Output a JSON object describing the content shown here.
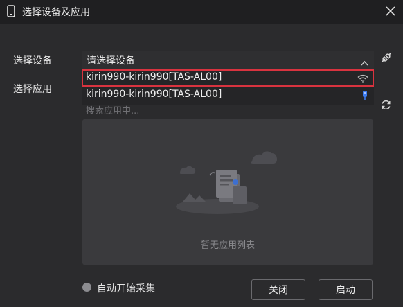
{
  "window": {
    "title": "选择设备及应用",
    "title_icon": "phone-icon",
    "close_icon": "close-icon"
  },
  "device": {
    "label": "选择设备",
    "placeholder": "请选择设备",
    "expanded": true,
    "options": [
      {
        "name": "kirin990-kirin990[TAS-AL00]",
        "connection": "wifi-icon",
        "selected": true
      },
      {
        "name": "kirin990-kirin990[TAS-AL00]",
        "connection": "usb-icon",
        "selected": false
      }
    ],
    "side_icon": "connect-icon"
  },
  "app": {
    "label": "选择应用",
    "search_placeholder": "搜索应用中...",
    "refresh_icon": "refresh-icon",
    "empty_text": "暂无应用列表",
    "empty_icon": "empty-documents-icon"
  },
  "footer": {
    "auto_start_label": "自动开始采集",
    "auto_start_checked": false,
    "close_label": "关闭",
    "start_label": "启动"
  },
  "colors": {
    "background": "#2b2b2d",
    "titlebar": "#1f1f21",
    "selection_border": "#d9333f",
    "usb_icon": "#3d7cf0"
  }
}
